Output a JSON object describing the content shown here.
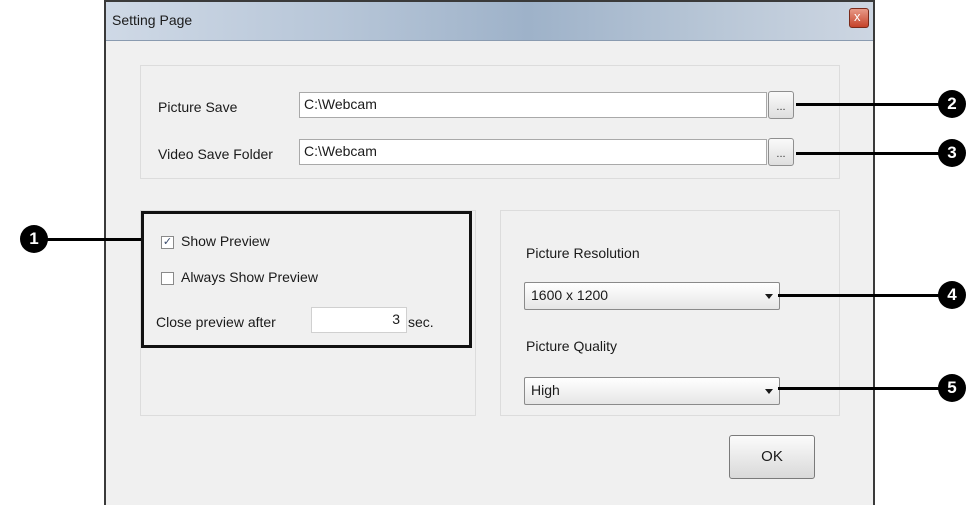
{
  "window": {
    "title": "Setting Page",
    "close_glyph": "x"
  },
  "save_section": {
    "picture_save_label": "Picture Save",
    "picture_save_path": "C:\\Webcam",
    "video_save_label": "Video Save Folder",
    "video_save_path": "C:\\Webcam",
    "browse_label": "..."
  },
  "preview_section": {
    "show_preview_label": "Show Preview",
    "show_preview_checked": true,
    "always_show_label": "Always Show Preview",
    "always_show_checked": false,
    "close_after_label": "Close preview after",
    "close_after_value": "3",
    "close_after_unit": "sec."
  },
  "picture_section": {
    "resolution_label": "Picture Resolution",
    "resolution_value": "1600 x 1200",
    "quality_label": "Picture Quality",
    "quality_value": "High"
  },
  "ok_label": "OK",
  "callouts": [
    "1",
    "2",
    "3",
    "4",
    "5"
  ],
  "colors": {
    "callout": "#000000",
    "dialog_bg": "#f0f0f0",
    "close_button": "#c5432a"
  }
}
